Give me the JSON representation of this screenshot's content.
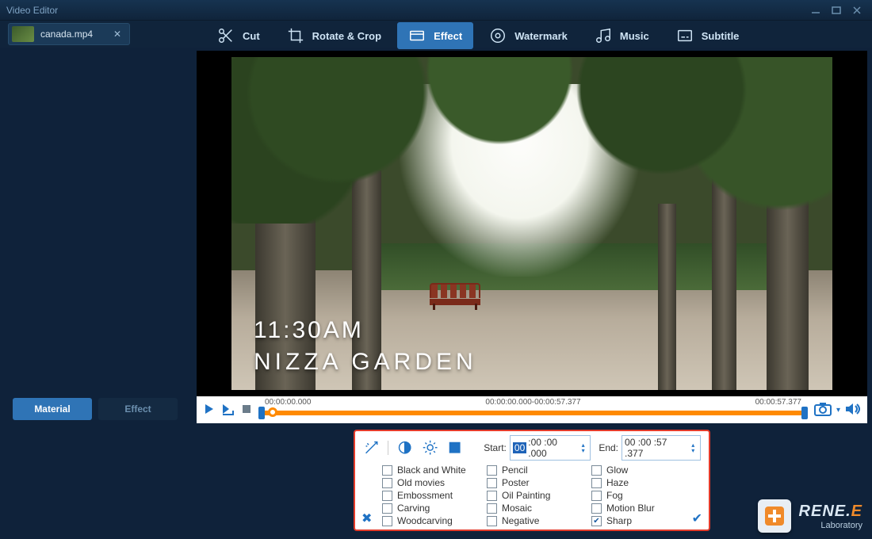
{
  "window": {
    "title": "Video Editor"
  },
  "media_tab": {
    "filename": "canada.mp4"
  },
  "toolbar": {
    "cut": "Cut",
    "rotate": "Rotate & Crop",
    "effect": "Effect",
    "watermark": "Watermark",
    "music": "Music",
    "subtitle": "Subtitle",
    "active": "effect"
  },
  "left_tabs": {
    "material": "Material",
    "effect": "Effect",
    "active": "material"
  },
  "preview_overlay": {
    "time": "11:30AM",
    "place": "NIZZA GARDEN"
  },
  "playbar": {
    "time_left": "00:00:00.000",
    "time_center": "00:00:00.000-00:00:57.377",
    "time_right": "00:00:57.377"
  },
  "effect_panel": {
    "start_label": "Start:",
    "end_label": "End:",
    "start_value": {
      "hh": "00",
      "rest": ":00 :00 .000"
    },
    "end_value": "00 :00 :57 .377",
    "options": [
      {
        "label": "Black and White",
        "checked": false
      },
      {
        "label": "Pencil",
        "checked": false
      },
      {
        "label": "Glow",
        "checked": false
      },
      {
        "label": "Old movies",
        "checked": false
      },
      {
        "label": "Poster",
        "checked": false
      },
      {
        "label": "Haze",
        "checked": false
      },
      {
        "label": "Embossment",
        "checked": false
      },
      {
        "label": "Oil Painting",
        "checked": false
      },
      {
        "label": "Fog",
        "checked": false
      },
      {
        "label": "Carving",
        "checked": false
      },
      {
        "label": "Mosaic",
        "checked": false
      },
      {
        "label": "Motion Blur",
        "checked": false
      },
      {
        "label": "Woodcarving",
        "checked": false
      },
      {
        "label": "Negative",
        "checked": false
      },
      {
        "label": "Sharp",
        "checked": true
      }
    ]
  },
  "brand": {
    "name_a": "RENE.",
    "name_b": "E",
    "sub": "Laboratory"
  }
}
